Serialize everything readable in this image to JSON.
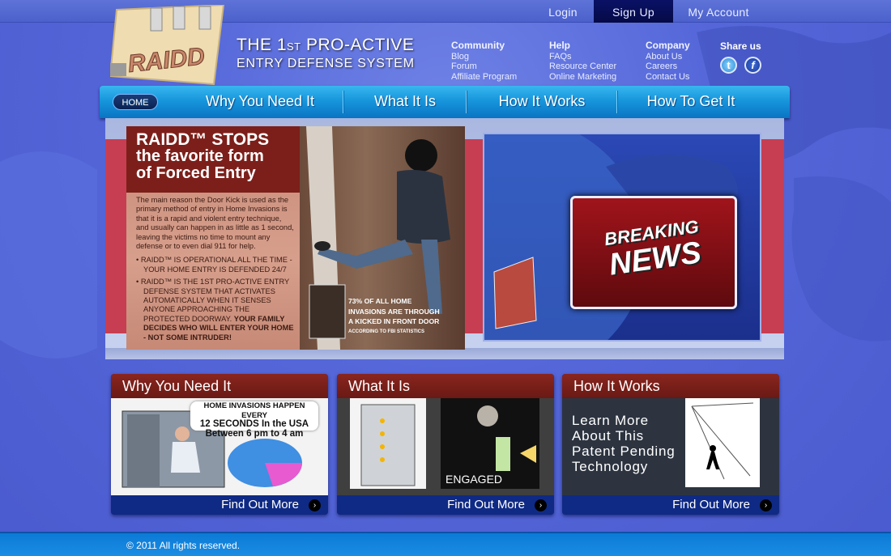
{
  "topbar": {
    "login": "Login",
    "signup": "Sign Up",
    "account": "My Account"
  },
  "logo": {
    "text": "RAIDD"
  },
  "tagline": {
    "line1_a": "THE 1",
    "line1_b": "ST",
    "line1_c": " PRO-ACTIVE",
    "line2": "ENTRY DEFENSE SYSTEM"
  },
  "links": {
    "community": {
      "title": "Community",
      "items": [
        "Blog",
        "Forum",
        "Affiliate Program"
      ]
    },
    "help": {
      "title": "Help",
      "items": [
        "FAQs",
        "Resource Center",
        "Online Marketing"
      ]
    },
    "company": {
      "title": "Company",
      "items": [
        "About Us",
        "Careers",
        "Contact Us"
      ]
    },
    "share": {
      "title": "Share us",
      "icons": [
        "twitter-icon",
        "facebook-icon"
      ]
    }
  },
  "nav": {
    "home": "HOME",
    "items": [
      "Why You Need It",
      "What It Is",
      "How It Works",
      "How To Get It"
    ]
  },
  "hero": {
    "headline_1": "RAIDD™ STOPS",
    "headline_2": "the favorite form",
    "headline_3": "of Forced Entry",
    "body": "The main reason the Door Kick is used as the primary method of entry in Home Invasions is that it is a rapid and violent entry technique, and usually can happen in as little as 1 second, leaving the victims no time to mount any defense or to even dial 911 for help.",
    "bullet_1": "• RAIDD™ IS OPERATIONAL ALL THE TIME - YOUR HOME ENTRY IS DEFENDED 24/7",
    "bullet_2_a": "• RAIDD™ IS THE 1ST PRO-ACTIVE ENTRY DEFENSE SYSTEM THAT ACTIVATES AUTOMATICALLY WHEN IT SENSES ANYONE APPROACHING THE PROTECTED DOORWAY. ",
    "bullet_2_b": "YOUR FAMILY DECIDES WHO WILL ENTER YOUR HOME - NOT SOME INTRUDER!",
    "caption_1": "73% OF ALL HOME",
    "caption_2": "INVASIONS ARE THROUGH",
    "caption_3": "A KICKED IN  FRONT DOOR",
    "caption_4": "ACCORDING TO FBI STATISTICS",
    "news_1": "BREAKING",
    "news_2": "NEWS"
  },
  "cards": [
    {
      "title": "Why You Need It",
      "btn": "Find Out More",
      "callout_1": "HOME INVASIONS HAPPEN EVERY",
      "callout_2": "12 SECONDS In the USA",
      "callout_3": "Between 6 pm to 4 am"
    },
    {
      "title": "What It Is",
      "btn": "Find Out More",
      "engaged": "ENGAGED"
    },
    {
      "title": "How It Works",
      "btn": "Find Out More",
      "learn_1": "Learn More",
      "learn_2": "About This",
      "learn_3": "Patent Pending",
      "learn_4": "Technology"
    }
  ],
  "footer": {
    "text": "© 2011 All rights reserved."
  },
  "colors": {
    "nav": "#1796dd",
    "card_title": "#8a251f",
    "hero_band": "#c73e52",
    "signup": "#050a45"
  }
}
